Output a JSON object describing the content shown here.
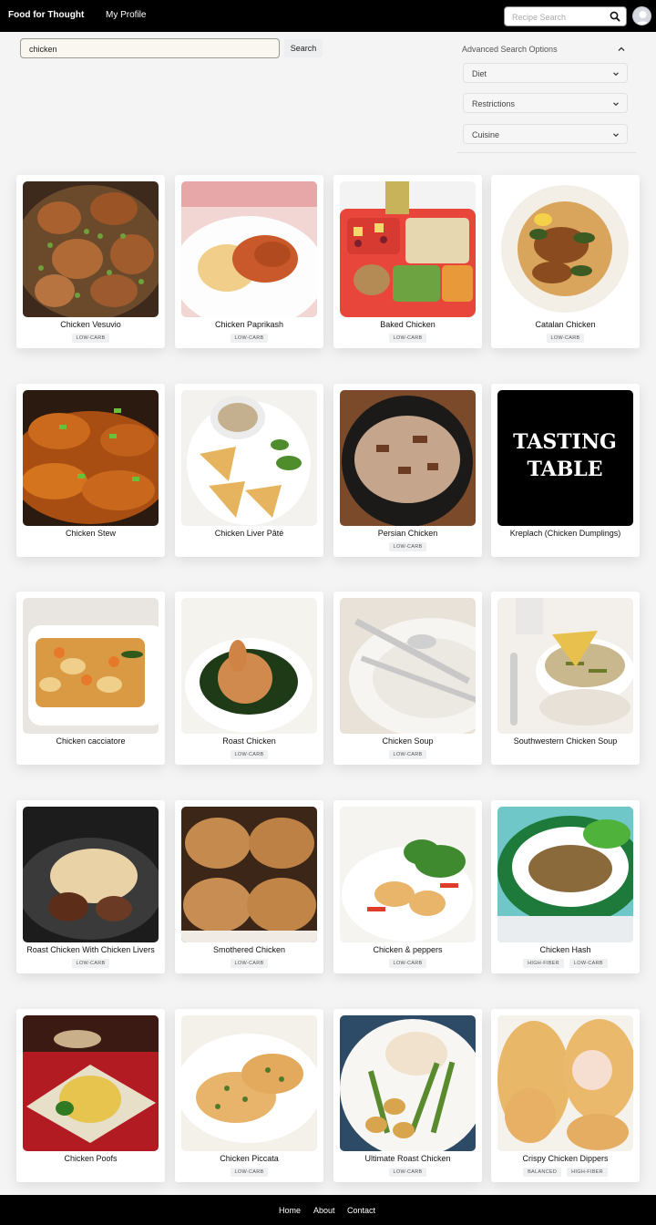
{
  "nav": {
    "brand": "Food for Thought",
    "profile": "My Profile",
    "search_placeholder": "Recipe Search"
  },
  "search": {
    "value": "chicken",
    "button": "Search"
  },
  "advanced": {
    "title": "Advanced Search Options",
    "diet": "Diet",
    "restrictions": "Restrictions",
    "cuisine": "Cuisine"
  },
  "recipes": [
    {
      "title": "Chicken Vesuvio",
      "tags": [
        "LOW-CARB"
      ],
      "image": "braised-chicken-peas-pan"
    },
    {
      "title": "Chicken Paprikash",
      "tags": [
        "LOW-CARB"
      ],
      "image": "chicken-paprikash-noodles"
    },
    {
      "title": "Baked Chicken",
      "tags": [
        "LOW-CARB"
      ],
      "image": "school-lunch-tray"
    },
    {
      "title": "Catalan Chicken",
      "tags": [
        "LOW-CARB"
      ],
      "image": "chicken-greens-plate"
    },
    {
      "title": "Chicken Stew",
      "tags": [],
      "image": "glazed-chicken-pieces"
    },
    {
      "title": "Chicken Liver Pâté",
      "tags": [],
      "image": "pate-with-crackers"
    },
    {
      "title": "Persian Chicken",
      "tags": [
        "LOW-CARB"
      ],
      "image": "rice-dish-plate"
    },
    {
      "title": "Kreplach (Chicken Dumplings)",
      "tags": [],
      "image": "tasting-table-logo"
    },
    {
      "title": "Chicken cacciatore",
      "tags": [],
      "image": "casserole-dish"
    },
    {
      "title": "Roast Chicken",
      "tags": [
        "LOW-CARB"
      ],
      "image": "roast-chicken-kale"
    },
    {
      "title": "Chicken Soup",
      "tags": [
        "LOW-CARB"
      ],
      "image": "empty-plate-cutlery"
    },
    {
      "title": "Southwestern Chicken Soup",
      "tags": [],
      "image": "soup-bowl-chips"
    },
    {
      "title": "Roast Chicken With Chicken Livers",
      "tags": [
        "LOW-CARB"
      ],
      "image": "roast-chicken-dark-plate"
    },
    {
      "title": "Smothered Chicken",
      "tags": [
        "LOW-CARB"
      ],
      "image": "smothered-chicken"
    },
    {
      "title": "Chicken & peppers",
      "tags": [
        "LOW-CARB"
      ],
      "image": "chicken-legs-salad"
    },
    {
      "title": "Chicken Hash",
      "tags": [
        "HIGH-FIBER",
        "LOW-CARB"
      ],
      "image": "hash-green-plate"
    },
    {
      "title": "Chicken Poofs",
      "tags": [],
      "image": "pastry-parcel-plate"
    },
    {
      "title": "Chicken Piccata",
      "tags": [
        "LOW-CARB"
      ],
      "image": "piccata-capers"
    },
    {
      "title": "Ultimate Roast Chicken",
      "tags": [
        "LOW-CARB"
      ],
      "image": "roast-chicken-asparagus"
    },
    {
      "title": "Crispy Chicken Dippers",
      "tags": [
        "BALANCED",
        "HIGH-FIBER"
      ],
      "image": "crescent-dippers"
    }
  ],
  "footer": {
    "home": "Home",
    "about": "About",
    "contact": "Contact"
  },
  "colors": {
    "nav_bg": "#000000",
    "page_bg": "#f4f4f4",
    "tag_bg": "#eef0f2"
  }
}
